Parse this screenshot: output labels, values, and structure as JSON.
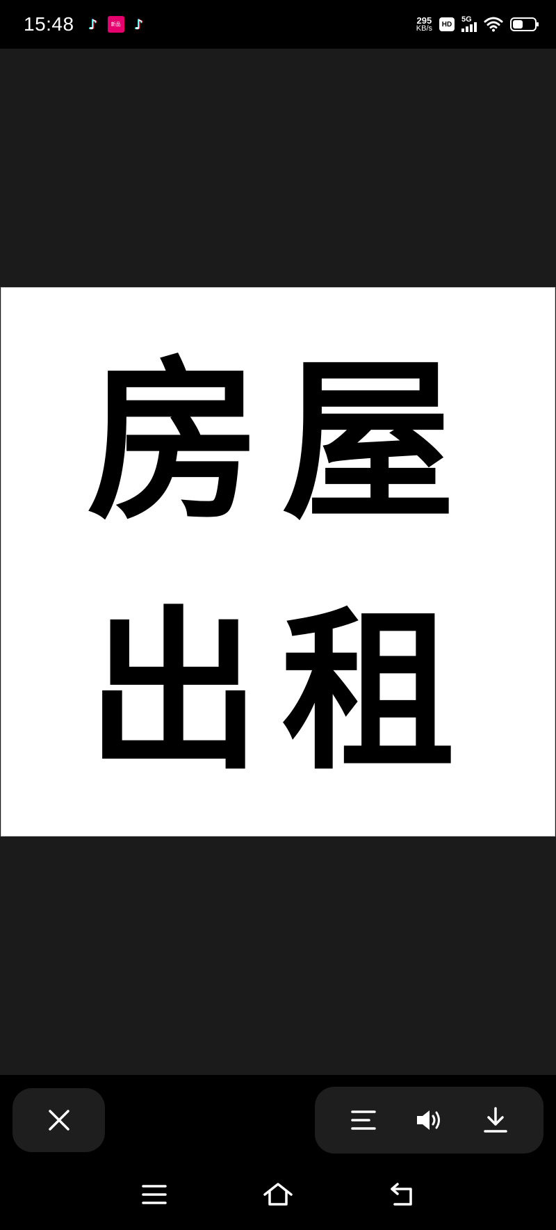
{
  "status_bar": {
    "time": "15:48",
    "app_badge_text": "新品",
    "network_speed_value": "295",
    "network_speed_unit": "KB/s",
    "hd_label": "HD",
    "network_type": "5G",
    "icons": [
      "tiktok-icon",
      "app-badge-icon",
      "tiktok-icon",
      "hd-icon",
      "signal-icon",
      "wifi-icon",
      "battery-icon"
    ]
  },
  "image": {
    "characters": [
      "房",
      "屋",
      "出",
      "租"
    ]
  },
  "controls": {
    "icons": [
      "close-icon",
      "menu-icon",
      "speaker-icon",
      "download-icon"
    ]
  },
  "nav_bar": {
    "icons": [
      "menu-icon",
      "home-icon",
      "back-icon"
    ]
  },
  "colors": {
    "background": "#000000",
    "viewer_background": "#1b1b1b",
    "control_surface": "#1e1e1e",
    "image_background": "#ffffff",
    "glyph": "#000000"
  }
}
